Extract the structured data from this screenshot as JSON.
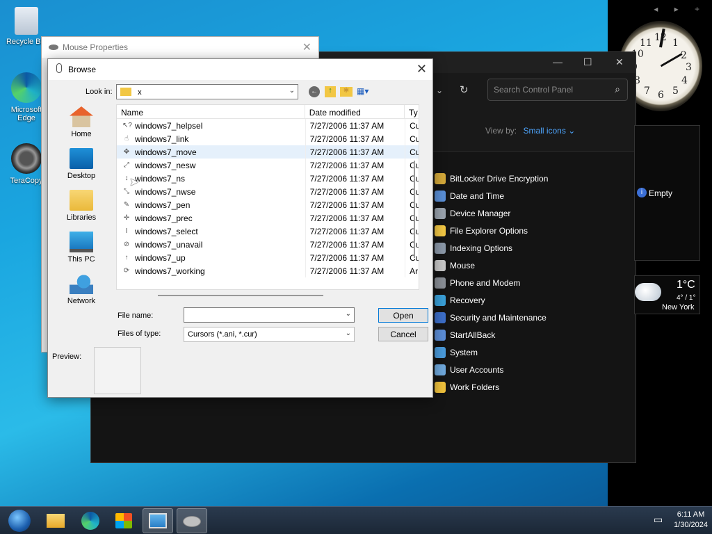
{
  "desktop": {
    "icons": [
      {
        "label": "Recycle Bin"
      },
      {
        "label": "Microsoft Edge"
      },
      {
        "label": "TeraCopy"
      }
    ]
  },
  "sidebar": {
    "nav": "◂ ▸ +",
    "clock_numbers": [
      "12",
      "1",
      "2",
      "3",
      "4",
      "5",
      "6",
      "7",
      "8",
      "9",
      "10",
      "11"
    ],
    "empty_label": "Empty",
    "weather": {
      "temp": "1°C",
      "range": "4° / 1°",
      "city": "New York"
    }
  },
  "control_panel": {
    "search_placeholder": "Search Control Panel",
    "view_by_label": "View by:",
    "view_by_value": "Small icons",
    "items": [
      {
        "label": "BitLocker Drive Encryption",
        "color": "#d4a93a"
      },
      {
        "label": "Date and Time",
        "color": "#5a8fd6"
      },
      {
        "label": "Device Manager",
        "color": "#9aa3ad"
      },
      {
        "label": "File Explorer Options",
        "color": "#f2c744"
      },
      {
        "label": "Indexing Options",
        "color": "#8b98a8"
      },
      {
        "label": "Mouse",
        "color": "#c9c9c9"
      },
      {
        "label": "Phone and Modem",
        "color": "#8a8f96"
      },
      {
        "label": "Recovery",
        "color": "#3aa0d8"
      },
      {
        "label": "Security and Maintenance",
        "color": "#3d6fc9"
      },
      {
        "label": "StartAllBack",
        "color": "#5c8ed8"
      },
      {
        "label": "System",
        "color": "#4a9bdc"
      },
      {
        "label": "User Accounts",
        "color": "#6fa8dc"
      },
      {
        "label": "Work Folders",
        "color": "#f0c23c"
      }
    ]
  },
  "mouse_properties": {
    "title": "Mouse Properties",
    "preview_label": "Preview:"
  },
  "browse": {
    "title": "Browse",
    "look_in_label": "Look in:",
    "look_in_value": "x",
    "columns": {
      "name": "Name",
      "date": "Date modified",
      "type": "Ty"
    },
    "places": [
      "Home",
      "Desktop",
      "Libraries",
      "This PC",
      "Network"
    ],
    "files": [
      {
        "name": "windows7_helpsel",
        "date": "7/27/2006 11:37 AM",
        "type": "Cu",
        "glyph": "↖?"
      },
      {
        "name": "windows7_link",
        "date": "7/27/2006 11:37 AM",
        "type": "Cu",
        "glyph": "☝"
      },
      {
        "name": "windows7_move",
        "date": "7/27/2006 11:37 AM",
        "type": "Cu",
        "glyph": "✥"
      },
      {
        "name": "windows7_nesw",
        "date": "7/27/2006 11:37 AM",
        "type": "Cu",
        "glyph": "⤢"
      },
      {
        "name": "windows7_ns",
        "date": "7/27/2006 11:37 AM",
        "type": "Cu",
        "glyph": "↕"
      },
      {
        "name": "windows7_nwse",
        "date": "7/27/2006 11:37 AM",
        "type": "Cu",
        "glyph": "⤡"
      },
      {
        "name": "windows7_pen",
        "date": "7/27/2006 11:37 AM",
        "type": "Cu",
        "glyph": "✎"
      },
      {
        "name": "windows7_prec",
        "date": "7/27/2006 11:37 AM",
        "type": "Cu",
        "glyph": "✛"
      },
      {
        "name": "windows7_select",
        "date": "7/27/2006 11:37 AM",
        "type": "Cu",
        "glyph": "I"
      },
      {
        "name": "windows7_unavail",
        "date": "7/27/2006 11:37 AM",
        "type": "Cu",
        "glyph": "⊘"
      },
      {
        "name": "windows7_up",
        "date": "7/27/2006 11:37 AM",
        "type": "Cu",
        "glyph": "↑"
      },
      {
        "name": "windows7_working",
        "date": "7/27/2006 11:37 AM",
        "type": "Ar",
        "glyph": "⟳"
      }
    ],
    "file_name_label": "File name:",
    "file_name_value": "",
    "files_of_type_label": "Files of type:",
    "files_of_type_value": "Cursors (*.ani, *.cur)",
    "open_label": "Open",
    "cancel_label": "Cancel"
  },
  "taskbar": {
    "time": "6:11 AM",
    "date": "1/30/2024"
  }
}
